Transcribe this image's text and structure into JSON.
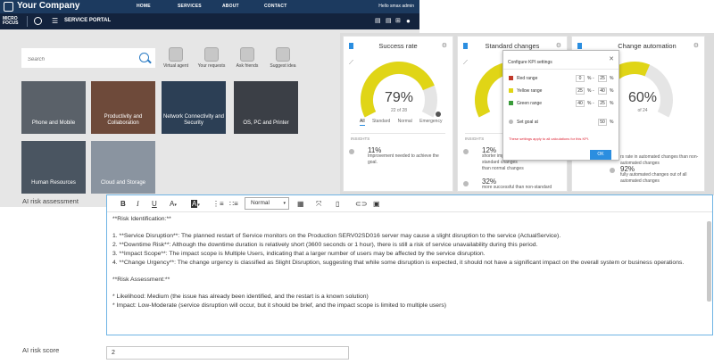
{
  "portal": {
    "company_name": "Your Company",
    "nav": [
      "HOME",
      "SERVICES",
      "ABOUT",
      "CONTACT"
    ],
    "user_label": "Hello smax admin",
    "brand_line1": "MICRO",
    "brand_line2": "FOCUS",
    "portal_title": "SERVICE PORTAL",
    "search_placeholder": "Search",
    "quick_actions": [
      "Virtual agent",
      "Your requests",
      "Ask friends",
      "Suggest idea"
    ],
    "tiles": [
      {
        "label": "Phone and Mobile",
        "color": "#5a6169"
      },
      {
        "label": "Productivity and Collaboration",
        "color": "#6e4a3a"
      },
      {
        "label": "Network Connectivity and Security",
        "color": "#2c3f55"
      },
      {
        "label": "OS, PC and Printer",
        "color": "#3b3f46"
      },
      {
        "label": "Human Resources",
        "color": "#4a5561"
      },
      {
        "label": "Cloud and Storage",
        "color": "#8a94a0"
      }
    ]
  },
  "dashboard": {
    "cards": [
      {
        "title": "Success rate",
        "pct": "79%",
        "sub": "22 of 28",
        "value": 0.79
      },
      {
        "title": "Standard changes",
        "pct": "",
        "sub": "",
        "value": 0.55
      },
      {
        "title": "Change automation",
        "pct": "60%",
        "sub": "of 24",
        "value": 0.6
      }
    ],
    "tabs": [
      "All",
      "Standard",
      "Normal",
      "Emergency"
    ],
    "insights_label": "INSIGHTS",
    "insights": [
      {
        "big": "11%",
        "text": "Improvement needed to achieve the goal."
      },
      {
        "big": "12%",
        "text": "shorter imp... standard changes than normal changes"
      },
      {
        "big": "32%",
        "text": "more successful than non-standard"
      },
      {
        "big": "",
        "text": "rs rate in automated changes than non-automated changes"
      },
      {
        "big": "92%",
        "text": "fully automated changes out of all automated changes"
      }
    ],
    "gauge_colors": {
      "fill": "#e0d516",
      "track": "#e5e5e5",
      "red": "#c0392b",
      "green": "#3a9b3a"
    }
  },
  "kpi_popup": {
    "title": "Configure KPI settings",
    "rows": [
      {
        "label": "Red range",
        "from": "0",
        "to": "25",
        "color": "#c0392b"
      },
      {
        "label": "Yellow range",
        "from": "25",
        "to": "40",
        "color": "#e0d516"
      },
      {
        "label": "Green range",
        "from": "40",
        "to": "25",
        "color": "#3a9b3a"
      }
    ],
    "goal_label": "Set goal at",
    "goal_value": "50",
    "note": "These settings apply to all calculations for this KPI.",
    "ok_label": "OK"
  },
  "form": {
    "risk_label": "AI risk assessment",
    "score_label": "AI risk score",
    "score_value": "2",
    "format_select": "Normal",
    "toolbar_icons": [
      "bold-icon",
      "italic-icon",
      "underline-icon",
      "font-color-icon",
      "background-color-icon",
      "ordered-list-icon",
      "unordered-list-icon",
      "table-icon",
      "fullscreen-icon",
      "source-icon",
      "link-icon",
      "image-icon"
    ],
    "content": [
      "**Risk Identification:**",
      "",
      "1. **Service Disruption**: The planned restart of Service monitors on the Production SERV02SD016 server may cause a slight disruption to the service (ActualService).",
      "2. **Downtime Risk**: Although the downtime duration is relatively short (3600 seconds or 1 hour), there is still a risk of service unavailability during this period.",
      "3. **Impact Scope**: The impact scope is Multiple Users, indicating that a larger number of users may be affected by the service disruption.",
      "4. **Change Urgency**: The change urgency is classified as Slight Disruption, suggesting that while some disruption is expected, it should not have a significant impact on the overall system or business operations.",
      "",
      "**Risk Assessment:**",
      "",
      "* Likelihood: Medium (the issue has already been identified, and the restart is a known solution)",
      "* Impact: Low-Moderate (service disruption will occur, but it should be brief, and the impact scope is limited to multiple users)"
    ]
  }
}
